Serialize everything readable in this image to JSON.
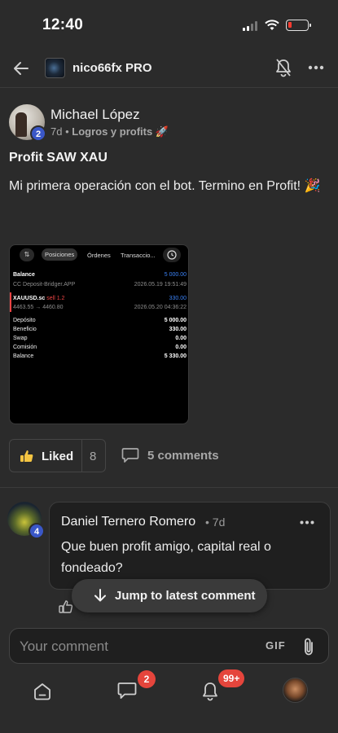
{
  "status": {
    "time": "12:40"
  },
  "header": {
    "group_name": "nico66fx PRO"
  },
  "post": {
    "author": "Michael López",
    "author_level": "2",
    "age": "7d",
    "category": "Logros y profits",
    "category_emoji": "🚀",
    "title": "Profit SAW XAU",
    "body": "Mi primera operación con el bot. Termino en Profit! 🎉",
    "likes_label": "Liked",
    "likes_count": "8",
    "comments_label": "5 comments"
  },
  "trade_screenshot": {
    "tabs": [
      "Posiciones",
      "Órdenes",
      "Transaccio..."
    ],
    "balance_label": "Balance",
    "balance_value": "5 000.00",
    "deposit_source": "CC Deposit-Bridger.APP",
    "deposit_time": "2026.05.19 19:51:49",
    "symbol": "XAUUSD.sc",
    "side": "sell 1.2",
    "trade_profit": "330.00",
    "price_move": "4463.55 → 4460.80",
    "trade_time": "2026.05.20 04:36:22",
    "summary": [
      {
        "label": "Depósito",
        "value": "5 000.00"
      },
      {
        "label": "Beneficio",
        "value": "330.00"
      },
      {
        "label": "Swap",
        "value": "0.00"
      },
      {
        "label": "Comisión",
        "value": "0.00"
      },
      {
        "label": "Balance",
        "value": "5 330.00"
      }
    ]
  },
  "comment": {
    "author": "Daniel Ternero Romero",
    "age": "• 7d",
    "level": "4",
    "text": "Que buen profit amigo, capital real o fondeado?"
  },
  "jump_button": {
    "label": "Jump to latest comment"
  },
  "composer": {
    "placeholder": "Your comment",
    "gif_label": "GIF"
  },
  "tabbar": {
    "chat_badge": "2",
    "notifications_badge": "99+"
  },
  "colors": {
    "background": "#2b2b2b",
    "level_badge": "#3a57c7",
    "notification_badge": "#e5453c"
  }
}
